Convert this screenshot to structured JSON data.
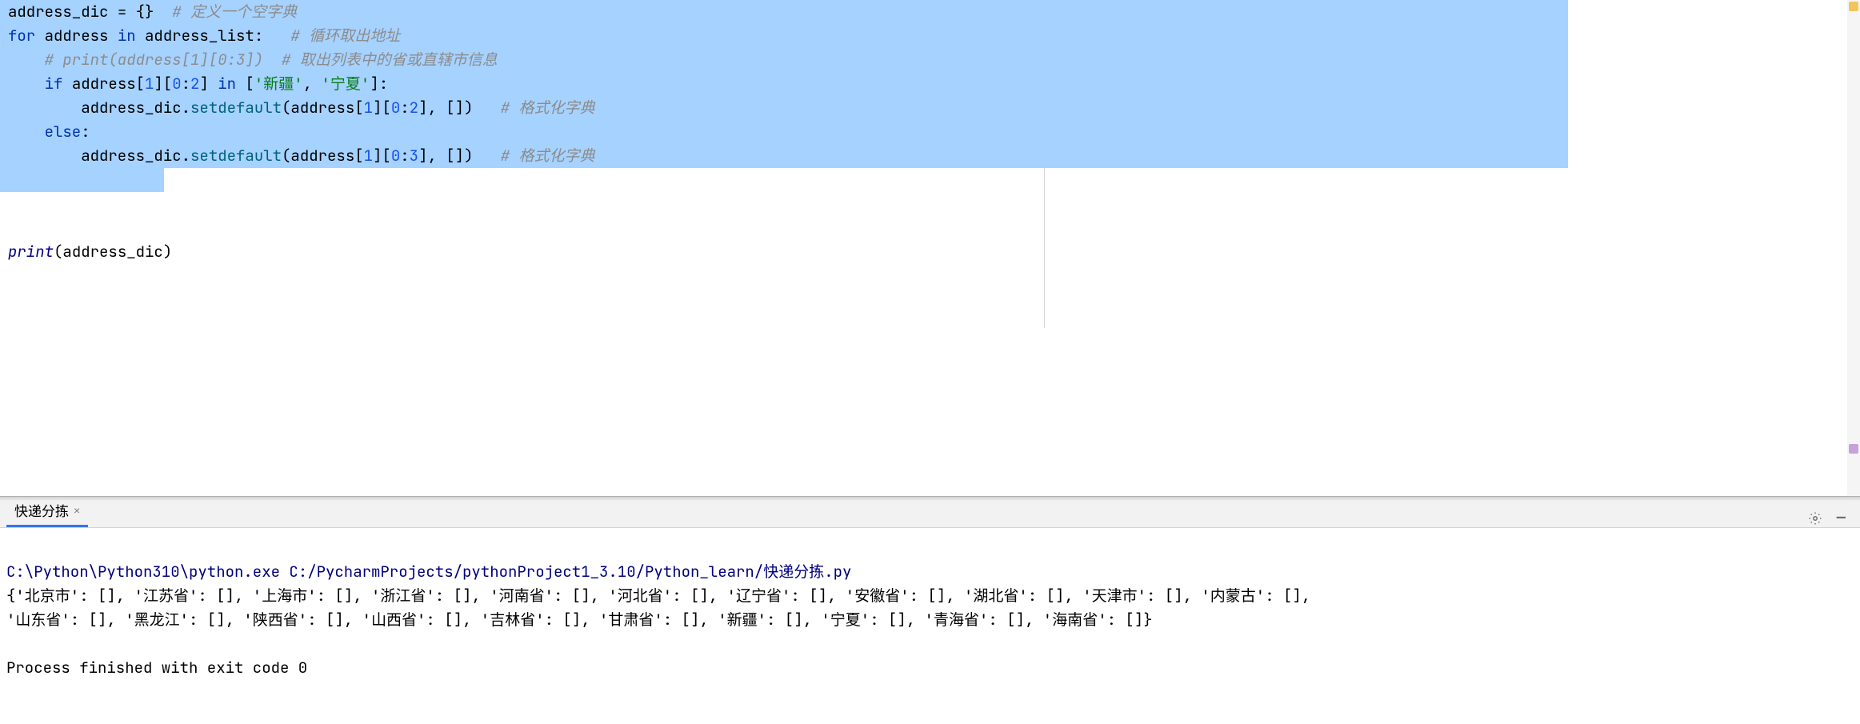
{
  "code": {
    "line1": {
      "a": "address_dic ",
      "b": "= {}  ",
      "c": "# 定义一个空字典"
    },
    "line2": {
      "a": "for ",
      "b": "address ",
      "c": "in ",
      "d": "address_list:   ",
      "e": "# 循环取出地址"
    },
    "line3": {
      "a": "    # print(address[1][0:3])  # 取出列表中的省或直辖市信息"
    },
    "line4": {
      "a": "    if ",
      "b": "address[",
      "c": "1",
      "d": "][",
      "e": "0",
      "f": ":",
      "g": "2",
      "h": "] ",
      "i": "in ",
      "j": "[",
      "k": "'新疆'",
      "l": ", ",
      "m": "'宁夏'",
      "n": "]:"
    },
    "line5": {
      "a": "        address_dic.",
      "b": "setdefault",
      "c": "(address[",
      "d": "1",
      "e": "][",
      "f": "0",
      "g": ":",
      "h": "2",
      "i": "], [])   ",
      "j": "# 格式化字典"
    },
    "line6": {
      "a": "    else",
      "b": ":"
    },
    "line7": {
      "a": "        address_dic.",
      "b": "setdefault",
      "c": "(address[",
      "d": "1",
      "e": "][",
      "f": "0",
      "g": ":",
      "h": "3",
      "i": "], [])   ",
      "j": "# 格式化字典"
    },
    "line8": {
      "a": "print",
      "b": "(address_dic)"
    }
  },
  "tab": {
    "label": "快递分拣",
    "close": "×"
  },
  "tools": {
    "gear": "⚙",
    "minus": "—"
  },
  "console": {
    "path": "C:\\Python\\Python310\\python.exe C:/PycharmProjects/pythonProject1_3.10/Python_learn/快递分拣.py",
    "out1": "{'北京市': [], '江苏省': [], '上海市': [], '浙江省': [], '河南省': [], '河北省': [], '辽宁省': [], '安徽省': [], '湖北省': [], '天津市': [], '内蒙古': [], ",
    "out2": "'山东省': [], '黑龙江': [], '陕西省': [], '山西省': [], '吉林省': [], '甘肃省': [], '新疆': [], '宁夏': [], '青海省': [], '海南省': []}",
    "exit": "Process finished with exit code 0"
  }
}
